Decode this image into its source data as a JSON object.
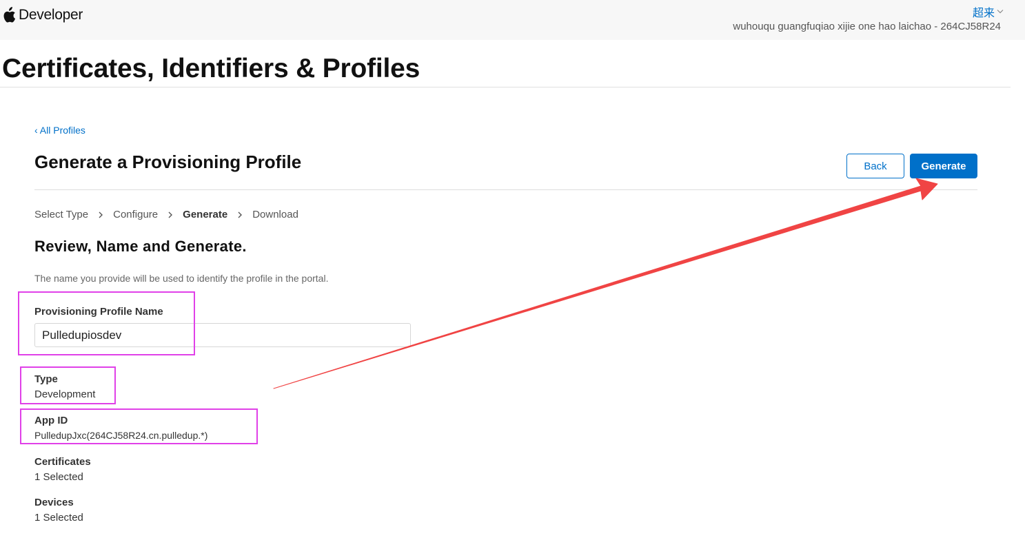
{
  "header": {
    "brand": "Developer",
    "language": "超来",
    "team": "wuhouqu guangfuqiao xijie one hao laichao - 264CJ58R24"
  },
  "page_title": "Certificates, Identifiers & Profiles",
  "nav": {
    "back_link": "‹ All Profiles"
  },
  "section": {
    "title": "Generate a Provisioning Profile",
    "back_button": "Back",
    "generate_button": "Generate"
  },
  "steps": [
    {
      "label": "Select Type",
      "active": false
    },
    {
      "label": "Configure",
      "active": false
    },
    {
      "label": "Generate",
      "active": true
    },
    {
      "label": "Download",
      "active": false
    }
  ],
  "form": {
    "subtitle": "Review, Name and Generate.",
    "description": "The name you provide will be used to identify the profile in the portal.",
    "name_label": "Provisioning Profile Name",
    "name_value": "Pulledupiosdev"
  },
  "details": {
    "type_label": "Type",
    "type_value": "Development",
    "appid_label": "App ID",
    "appid_value": "PulledupJxc(264CJ58R24.cn.pulledup.*)",
    "certificates_label": "Certificates",
    "certificates_value": "1 Selected",
    "devices_label": "Devices",
    "devices_value": "1 Selected"
  },
  "icons": {
    "logo": "apple-logo-icon",
    "language_chevron": "chevron-down-icon",
    "step_separator": "chevron-right-icon"
  },
  "colors": {
    "link": "#0070c9",
    "primary_button": "#0070c9",
    "highlight_box": "#e040e8",
    "annotation_arrow": "#f04444"
  }
}
